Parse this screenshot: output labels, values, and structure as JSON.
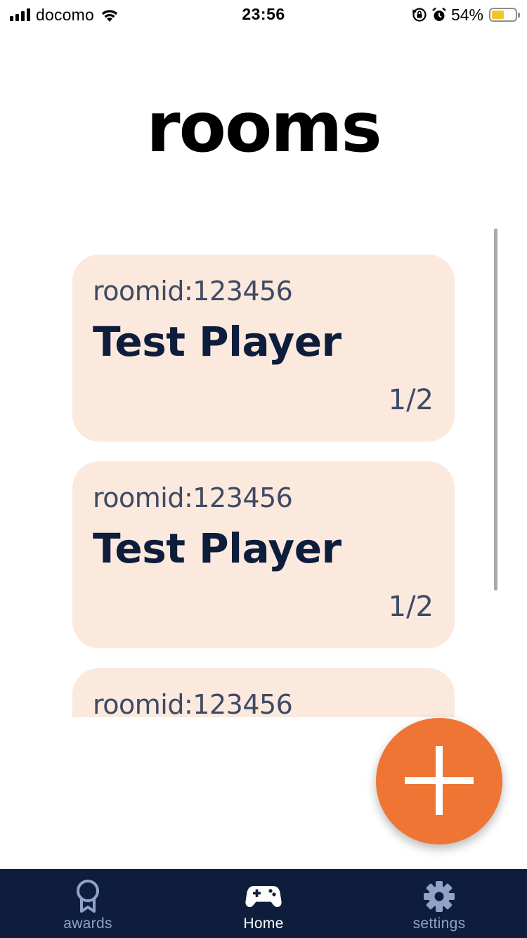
{
  "status_bar": {
    "carrier": "docomo",
    "time": "23:56",
    "battery_percent": "54%",
    "battery_level": 0.54,
    "battery_color": "#f4c430"
  },
  "page": {
    "title": "rooms"
  },
  "rooms": [
    {
      "room_id": "roomid:123456",
      "player": "Test Player",
      "count": "1/2"
    },
    {
      "room_id": "roomid:123456",
      "player": "Test Player",
      "count": "1/2"
    },
    {
      "room_id": "roomid:123456"
    }
  ],
  "fab": {
    "icon": "plus-icon",
    "color": "#ee7533"
  },
  "bottom_nav": {
    "background": "#0e1d3b",
    "items": [
      {
        "label": "awards",
        "icon": "award-ribbon-icon",
        "active": false,
        "color": "#8fa3c7"
      },
      {
        "label": "Home",
        "icon": "gamepad-icon",
        "active": true,
        "color": "#ffffff"
      },
      {
        "label": "settings",
        "icon": "gear-icon",
        "active": false,
        "color": "#8fa3c7"
      }
    ]
  },
  "colors": {
    "card_background": "#fbe9de",
    "card_title": "#0e1d3b",
    "card_text": "#3f4a63"
  }
}
